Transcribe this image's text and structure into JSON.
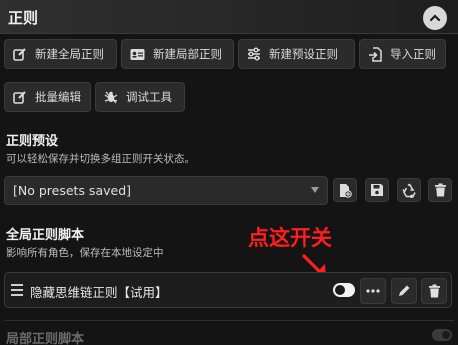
{
  "panel": {
    "title": "正则"
  },
  "toolbar": {
    "row1": [
      {
        "label": "新建全局正则",
        "icon": "edit-icon"
      },
      {
        "label": "新建局部正则",
        "icon": "id-card-icon"
      },
      {
        "label": "新建预设正则",
        "icon": "sliders-icon"
      },
      {
        "label": "导入正则",
        "icon": "file-import-icon"
      }
    ],
    "row2": [
      {
        "label": "批量编辑",
        "icon": "edit-icon"
      },
      {
        "label": "调试工具",
        "icon": "bug-icon"
      }
    ]
  },
  "presets": {
    "title": "正则预设",
    "description": "可以轻松保存并切换多组正则开关状态。",
    "selected": "[No presets saved]",
    "actions": [
      "file-add-icon",
      "save-icon",
      "recycle-icon",
      "trash-icon"
    ]
  },
  "global_scripts": {
    "title": "全局正则脚本",
    "description": "影响所有角色，保存在本地设定中",
    "items": [
      {
        "name": "隐藏思维链正则【试用】",
        "enabled": true
      }
    ]
  },
  "annotation": {
    "text": "点这开关",
    "color": "#ff1e1e"
  },
  "local_scripts": {
    "title": "局部正则脚本"
  }
}
